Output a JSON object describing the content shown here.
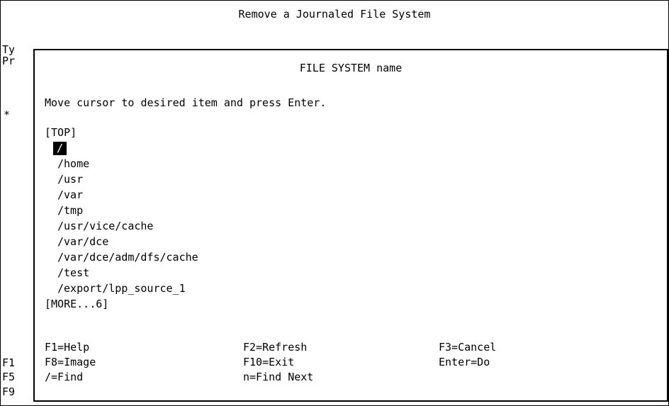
{
  "screen": {
    "title": "Remove a Journaled File System",
    "left_margin": {
      "ty": "Ty",
      "pr": "Pr",
      "asterisk": "*",
      "f1": "F1",
      "f5": "F5",
      "f9": "F9"
    },
    "right_margin": {
      "plus1": "+",
      "plus2": "+"
    }
  },
  "dialog": {
    "title": "FILE SYSTEM name",
    "instruction": "Move cursor to desired item and press Enter.",
    "top_marker": "[TOP]",
    "items": [
      "/",
      "/home",
      "/usr",
      "/var",
      "/tmp",
      "/usr/vice/cache",
      "/var/dce",
      "/var/dce/adm/dfs/cache",
      "/test",
      "/export/lpp_source_1"
    ],
    "selected_index": 0,
    "more_marker": "[MORE...6]",
    "function_keys": {
      "help": "F1=Help",
      "refresh": "F2=Refresh",
      "cancel": "F3=Cancel",
      "image": "F8=Image",
      "exit": "F10=Exit",
      "do": "Enter=Do",
      "find": "/=Find",
      "find_next": "n=Find Next"
    }
  }
}
